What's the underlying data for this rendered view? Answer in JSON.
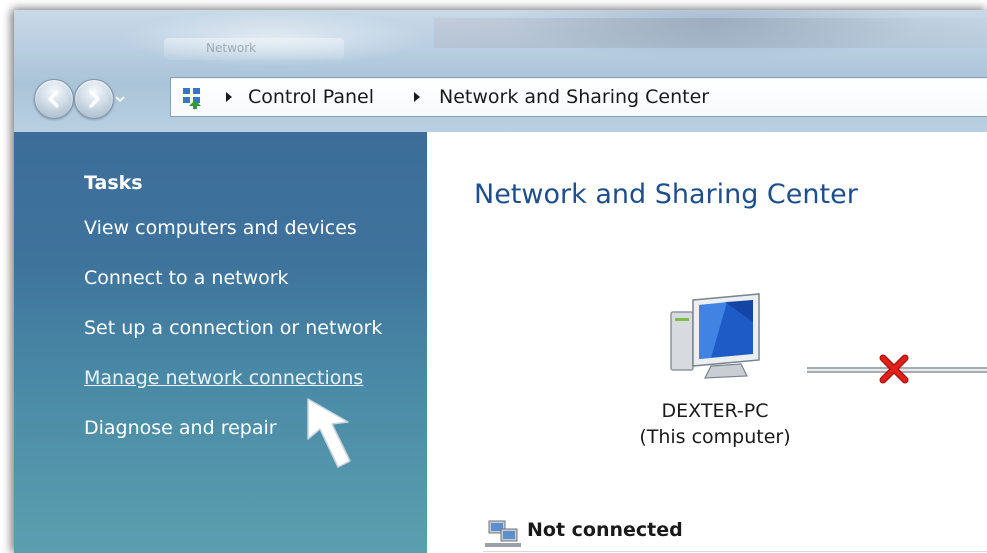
{
  "window": {
    "background_tab_title": "Network"
  },
  "address_bar": {
    "icon": "control-panel-icon",
    "breadcrumbs": [
      "Control Panel",
      "Network and Sharing Center"
    ]
  },
  "sidebar": {
    "heading": "Tasks",
    "items": [
      {
        "label": "View computers and devices"
      },
      {
        "label": "Connect to a network"
      },
      {
        "label": "Set up a connection or network"
      },
      {
        "label": "Manage network connections",
        "state": "hover"
      },
      {
        "label": "Diagnose and repair"
      }
    ]
  },
  "main": {
    "title": "Network and Sharing Center",
    "computer": {
      "name": "DEXTER-PC",
      "subtitle": "(This computer)"
    },
    "connection_status_icon": "red-x-icon",
    "status": {
      "label": "Not connected",
      "icon": "network-icon"
    }
  },
  "colors": {
    "sidebar_top": "#3c6d99",
    "sidebar_bottom": "#5b9faf",
    "title_blue": "#1e4f8c",
    "error_red": "#e0201a"
  }
}
